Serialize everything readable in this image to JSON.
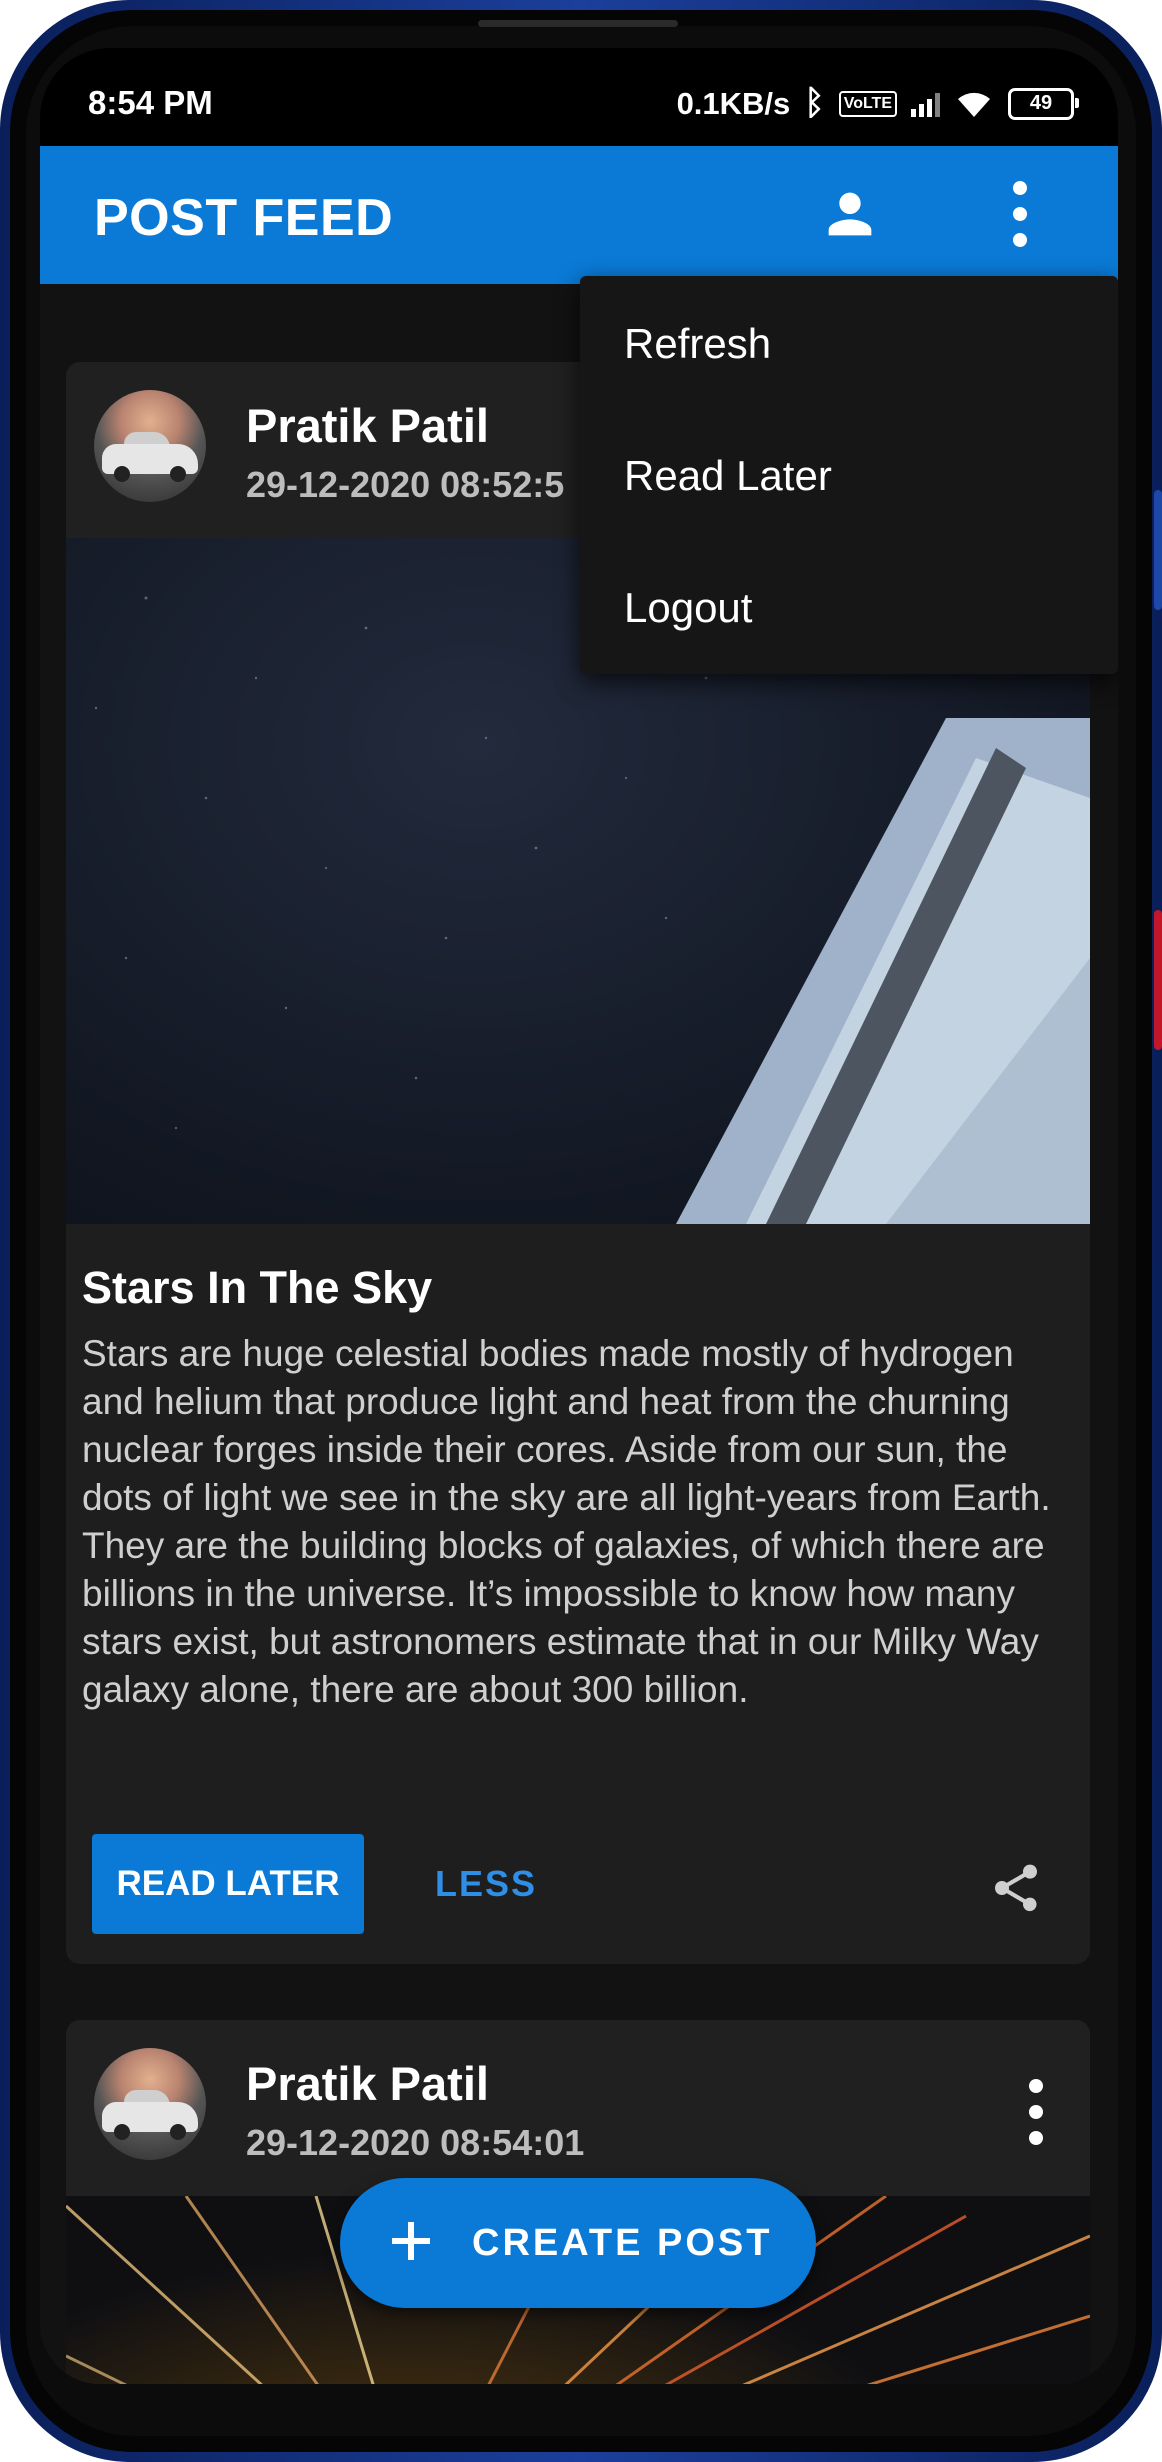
{
  "status_bar": {
    "time": "8:54 PM",
    "network_speed": "0.1KB/s",
    "volte": "Vo LTE",
    "battery": "49"
  },
  "app_bar": {
    "title": "POST FEED",
    "account_icon": "person-icon",
    "menu_icon": "more-vert-icon"
  },
  "popup_menu": {
    "items": [
      {
        "label": "Refresh"
      },
      {
        "label": "Read Later"
      },
      {
        "label": "Logout"
      }
    ]
  },
  "posts": [
    {
      "author": "Pratik Patil",
      "date": "29-12-2020 08:52:5",
      "title": "Stars In The Sky",
      "body": "Stars are huge celestial bodies made mostly of hydrogen and helium that produce light and heat from the churning nuclear forges inside their cores. Aside from our sun, the dots of light we see in the sky are all light-years from Earth. They are the building blocks of galaxies, of which there are billions in the universe. It’s impossible to know how many stars exist, but astronomers estimate that in our Milky Way galaxy alone, there are about 300 billion.",
      "read_later_label": "READ LATER",
      "less_label": "LESS"
    },
    {
      "author": "Pratik Patil",
      "date": "29-12-2020 08:54:01"
    }
  ],
  "fab": {
    "label": "CREATE POST"
  },
  "colors": {
    "primary": "#0a7ad6",
    "background": "#121212",
    "card": "#1e1e1e",
    "menu": "#161616",
    "link": "#2f8fe6"
  }
}
